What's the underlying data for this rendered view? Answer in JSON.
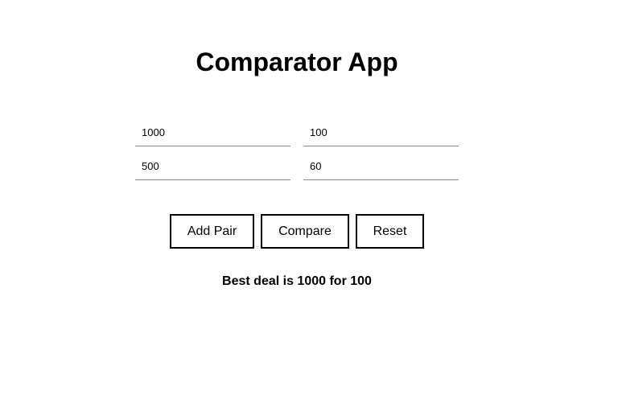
{
  "app": {
    "title": "Comparator App"
  },
  "pairs": [
    {
      "amount": "1000",
      "price": "100"
    },
    {
      "amount": "500",
      "price": "60"
    }
  ],
  "buttons": {
    "add_pair": "Add Pair",
    "compare": "Compare",
    "reset": "Reset"
  },
  "result": {
    "text": "Best deal is 1000 for 100"
  }
}
